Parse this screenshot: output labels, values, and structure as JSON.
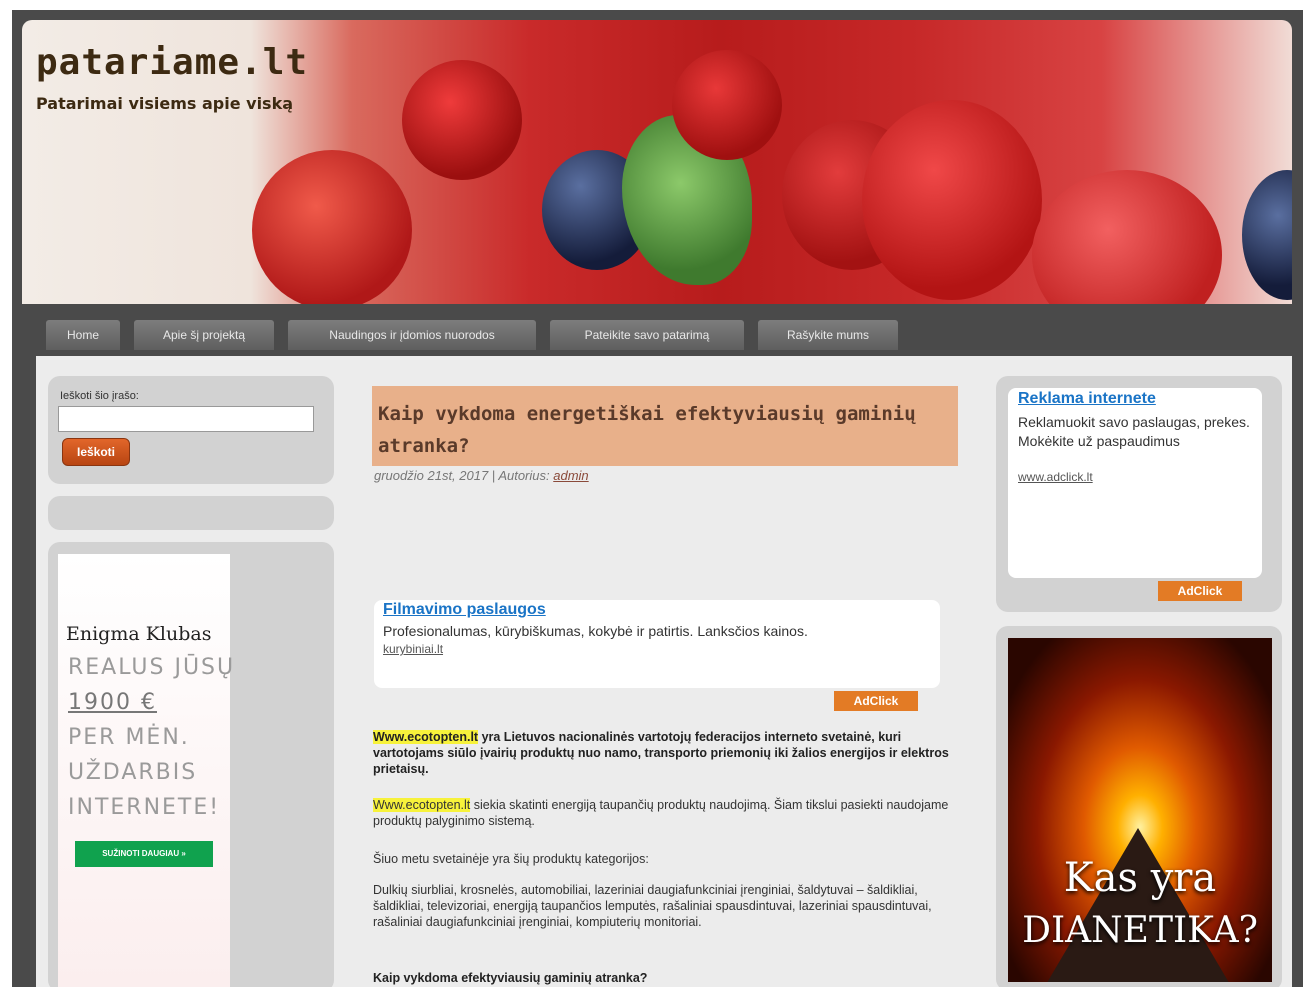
{
  "header": {
    "site_title": "patariame.lt",
    "tagline": "Patarimai visiems apie viską"
  },
  "nav": {
    "items": [
      {
        "label": "Home"
      },
      {
        "label": "Apie šį projektą"
      },
      {
        "label": "Naudingos ir įdomios nuorodos"
      },
      {
        "label": "Pateikite savo patarimą"
      },
      {
        "label": "Rašykite mums"
      }
    ]
  },
  "sidebar_left": {
    "search_label": "Ieškoti šio įrašo:",
    "search_value": "",
    "search_button": "Ieškoti",
    "ad": {
      "brand": "Enigma Klubas",
      "lines": [
        "REALUS JŪSŲ",
        "1900 €",
        "PER MĖN.",
        "UŽDARBIS",
        "INTERNETE!"
      ],
      "cta": "SUŽINOTI DAUGIAU »"
    }
  },
  "article": {
    "title": "Kaip vykdoma energetiškai efektyviausių gaminių atranka?",
    "meta_date": "gruodžio 21st, 2017 | Autorius:",
    "meta_author": "admin",
    "ad": {
      "title": "Filmavimo paslaugos",
      "text": "Profesionalumas, kūrybiškumas, kokybė ir patirtis. Lanksčios kainos.",
      "url": "kurybiniai.lt",
      "badge": "AdClick"
    },
    "p1_highlight": "Www.ecotopten.lt",
    "p1_rest": " yra Lietuvos nacionalinės vartotojų federacijos interneto svetainė, kuri vartotojams siūlo įvairių produktų nuo namo, transporto priemonių iki žalios energijos ir elektros prietaisų.",
    "p2_highlight": "Www.ecotopten.lt",
    "p2_rest": " siekia skatinti energiją taupančių produktų naudojimą. Šiam tikslui pasiekti naudojame produktų palyginimo sistemą.",
    "p3": "Šiuo metu svetainėje yra šių produktų kategorijos:",
    "p4": "Dulkių siurbliai, krosnelės, automobiliai, lazeriniai daugiafunkciniai įrenginiai, šaldytuvai – šaldikliai, šaldikliai, televizoriai, energiją taupančios lemputės, rašaliniai spausdintuvai, lazeriniai spausdintuvai, rašaliniai daugiafunkciniai įrenginiai, kompiuterių monitoriai.",
    "subheading": "Kaip vykdoma efektyviausių gaminių atranka?"
  },
  "sidebar_right": {
    "ad": {
      "title": "Reklama internete",
      "text": "Reklamuokit savo paslaugas, prekes. Mokėkite už paspaudimus",
      "url": "www.adclick.lt",
      "badge": "AdClick"
    },
    "banner_line1": "Kas yra",
    "banner_line2": "DIANETIKA?"
  }
}
